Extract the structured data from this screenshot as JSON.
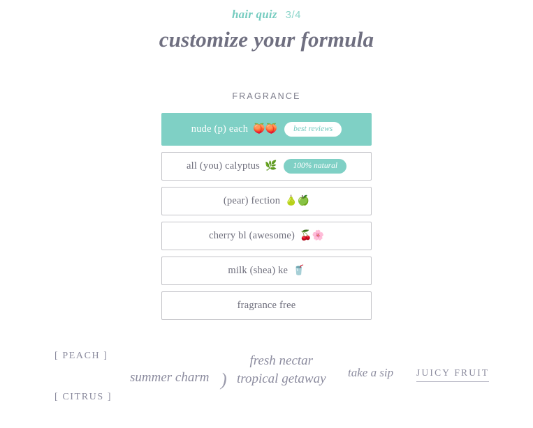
{
  "header": {
    "eyebrow_label": "hair quiz",
    "progress": "3/4",
    "title": "customize your formula",
    "accent_color": "#7fd0c5",
    "title_color": "#6f6f80"
  },
  "section": {
    "label": "FRAGRANCE"
  },
  "options": [
    {
      "label": "nude (p) each",
      "emoji": "🍑🍑",
      "badge": "best reviews",
      "badge_style": "light",
      "selected": true
    },
    {
      "label": "all (you) calyptus",
      "emoji": "🌿",
      "badge": "100% natural",
      "badge_style": "teal",
      "selected": false
    },
    {
      "label": "(pear) fection",
      "emoji": "🍐🍏",
      "badge": "",
      "badge_style": "",
      "selected": false
    },
    {
      "label": "cherry bl (awesome)",
      "emoji": "🍒🌸",
      "badge": "",
      "badge_style": "",
      "selected": false
    },
    {
      "label": "milk (shea) ke",
      "emoji": "🥤",
      "badge": "",
      "badge_style": "",
      "selected": false
    },
    {
      "label": "fragrance free",
      "emoji": "",
      "badge": "",
      "badge_style": "",
      "selected": false
    }
  ],
  "wordcloud": {
    "peach": "[ PEACH ]",
    "citrus": "[ CITRUS ]",
    "summer_charm": "summer charm",
    "paren": ")",
    "fresh_nectar": "fresh nectar",
    "tropical_getaway": "tropical getaway",
    "take_a_sip": "take a sip",
    "juicy_fruit": "JUICY FRUIT"
  }
}
